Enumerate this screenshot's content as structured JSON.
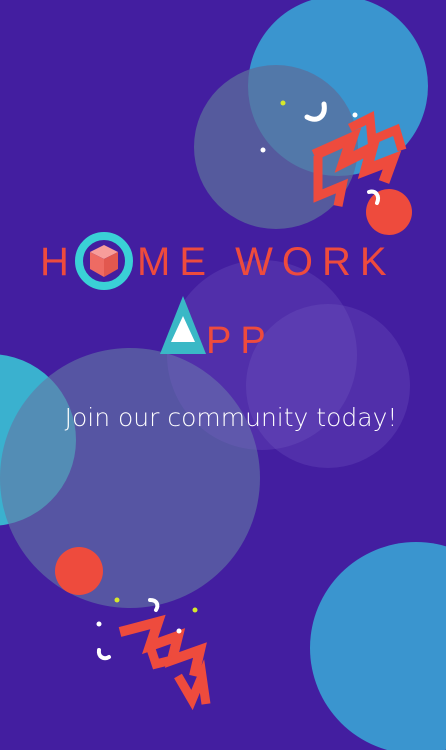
{
  "app": {
    "title_h": "H",
    "title_rest": "ME WORK",
    "title_app_rest": "PP",
    "tagline": "Join our community today!"
  },
  "icons": {
    "o_logo": "ring-with-cube-icon",
    "a_logo": "triangle-icon"
  },
  "colors": {
    "background": "#431ea0",
    "accent_red": "#ee4b3d",
    "accent_cyan": "#3ad1d6",
    "accent_blue": "#3a95cf",
    "circle_gray": "#4c5a96",
    "dot_lime": "#d6e82a"
  }
}
